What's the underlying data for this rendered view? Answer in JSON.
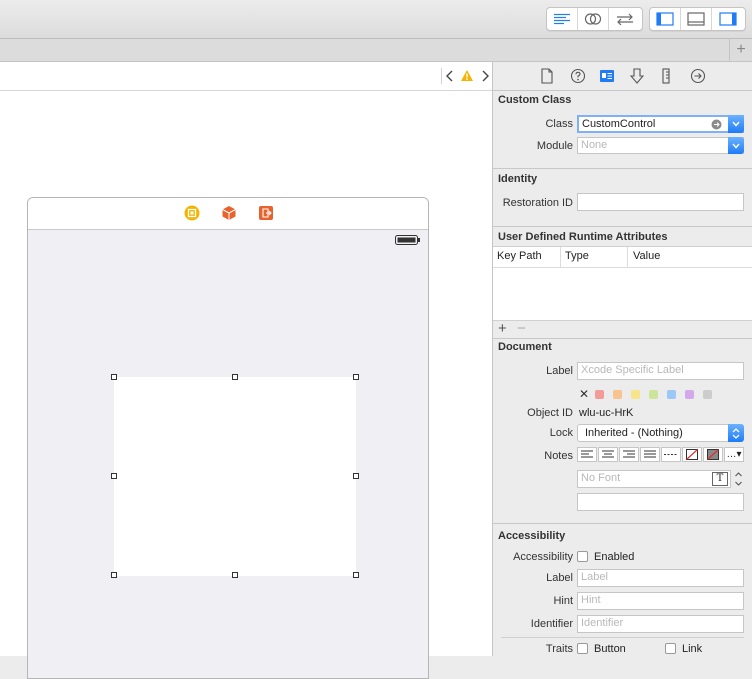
{
  "inspector": {
    "custom_class": {
      "title": "Custom Class",
      "class_label": "Class",
      "class_value": "CustomControl",
      "module_label": "Module",
      "module_placeholder": "None"
    },
    "identity": {
      "title": "Identity",
      "restoration_id_label": "Restoration ID",
      "restoration_id_value": ""
    },
    "runtime_attributes": {
      "title": "User Defined Runtime Attributes",
      "columns": [
        "Key Path",
        "Type",
        "Value"
      ],
      "add_symbol": "+",
      "remove_symbol": "−"
    },
    "document": {
      "title": "Document",
      "label_label": "Label",
      "label_placeholder": "Xcode Specific Label",
      "clear_symbol": "✕",
      "swatch_colors": [
        "#f39b98",
        "#f7c38f",
        "#f6e58b",
        "#cde59a",
        "#9bc8f5",
        "#d3a9ec",
        "#cccccc"
      ],
      "object_id_label": "Object ID",
      "object_id_value": "wlu-uc-HrK",
      "lock_label": "Lock",
      "lock_value": "Inherited - (Nothing)",
      "notes_label": "Notes",
      "font_placeholder": "No Font"
    },
    "accessibility": {
      "title": "Accessibility",
      "accessibility_label": "Accessibility",
      "enabled_label": "Enabled",
      "label_label": "Label",
      "label_placeholder": "Label",
      "hint_label": "Hint",
      "hint_placeholder": "Hint",
      "identifier_label": "Identifier",
      "identifier_placeholder": "Identifier",
      "traits_label": "Traits",
      "button_label": "Button",
      "link_label": "Link"
    }
  },
  "colors": {
    "accent": "#1f7bf6",
    "scene_icon_yellow": "#f5b400",
    "scene_icon_orange": "#e8622c",
    "warning": "#f5b400"
  }
}
